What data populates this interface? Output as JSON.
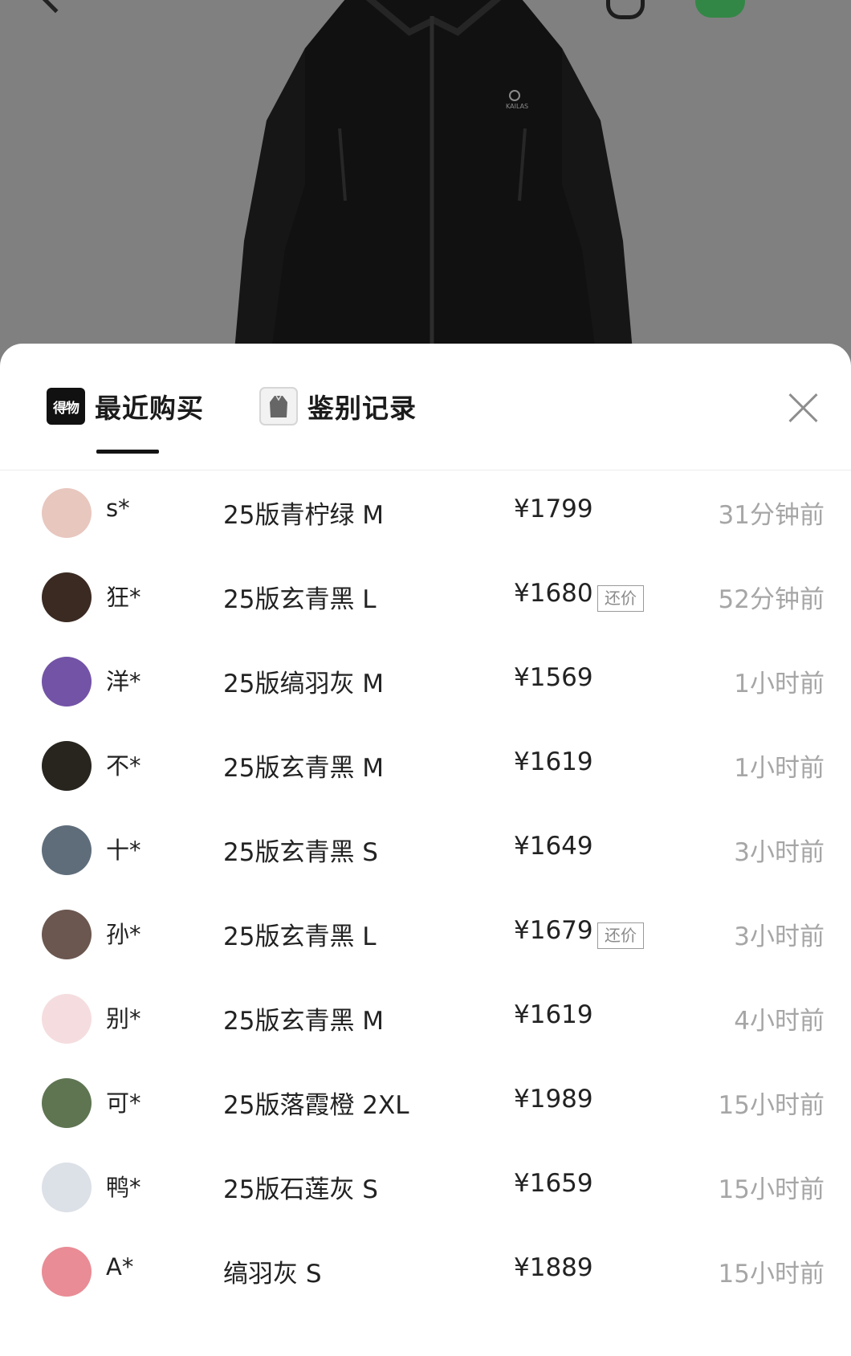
{
  "tabs": {
    "recent": {
      "logo_text": "得物",
      "label": "最近购买"
    },
    "authentication": {
      "label": "鉴别记录"
    }
  },
  "jacket_brand": "KAILAS",
  "records": [
    {
      "user": "s*",
      "item": "25版青柠绿 M",
      "price": "¥1799",
      "tag": "",
      "time": "31分钟前",
      "avatar_color": "#e8c7bf"
    },
    {
      "user": "狂*",
      "item": "25版玄青黑 L",
      "price": "¥1680",
      "tag": "还价",
      "time": "52分钟前",
      "avatar_color": "#3a2a22"
    },
    {
      "user": "洋*",
      "item": "25版缟羽灰 M",
      "price": "¥1569",
      "tag": "",
      "time": "1小时前",
      "avatar_color": "#7353a6"
    },
    {
      "user": "不*",
      "item": "25版玄青黑 M",
      "price": "¥1619",
      "tag": "",
      "time": "1小时前",
      "avatar_color": "#28251f"
    },
    {
      "user": "十*",
      "item": "25版玄青黑 S",
      "price": "¥1649",
      "tag": "",
      "time": "3小时前",
      "avatar_color": "#5f6d7b"
    },
    {
      "user": "孙*",
      "item": "25版玄青黑 L",
      "price": "¥1679",
      "tag": "还价",
      "time": "3小时前",
      "avatar_color": "#6b5750"
    },
    {
      "user": "别*",
      "item": "25版玄青黑 M",
      "price": "¥1619",
      "tag": "",
      "time": "4小时前",
      "avatar_color": "#f5dddf"
    },
    {
      "user": "可*",
      "item": "25版落霞橙 2XL",
      "price": "¥1989",
      "tag": "",
      "time": "15小时前",
      "avatar_color": "#5f7552"
    },
    {
      "user": "鸭*",
      "item": "25版石莲灰 S",
      "price": "¥1659",
      "tag": "",
      "time": "15小时前",
      "avatar_color": "#dce0e7"
    },
    {
      "user": "A*",
      "item": "缟羽灰 S",
      "price": "¥1889",
      "tag": "",
      "time": "15小时前",
      "avatar_color": "#e98c95"
    }
  ]
}
